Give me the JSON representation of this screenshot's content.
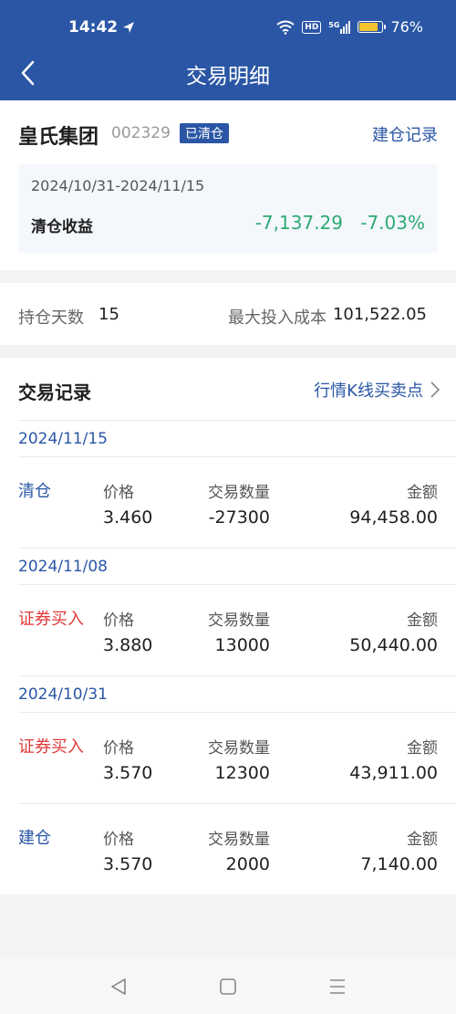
{
  "status_bar": {
    "time": "14:42",
    "hd": "HD",
    "network": "5G",
    "battery": "76%",
    "battery_level": 0.76
  },
  "header": {
    "title": "交易明细"
  },
  "stock": {
    "name": "皇氏集团",
    "code": "002329",
    "status": "已清仓",
    "open_record_link": "建仓记录"
  },
  "summary": {
    "period": "2024/10/31-2024/11/15",
    "label": "清仓收益",
    "profit": "-7,137.29",
    "profit_pct": "-7.03%"
  },
  "stats": {
    "days_label": "持仓天数",
    "days_value": "15",
    "cost_label": "最大投入成本",
    "cost_value": "101,522.05"
  },
  "records": {
    "title": "交易记录",
    "kline_link": "行情K线买卖点",
    "groups": [
      {
        "date": "2024/11/15",
        "items": [
          {
            "type": "清仓",
            "price_label": "价格",
            "price": "3.460",
            "qty_label": "交易数量",
            "qty": "-27300",
            "amount_label": "金额",
            "amount": "94,458.00"
          }
        ]
      },
      {
        "date": "2024/11/08",
        "items": [
          {
            "type": "证券买入",
            "price_label": "价格",
            "price": "3.880",
            "qty_label": "交易数量",
            "qty": "13000",
            "amount_label": "金额",
            "amount": "50,440.00"
          }
        ]
      },
      {
        "date": "2024/10/31",
        "items": [
          {
            "type": "证券买入",
            "price_label": "价格",
            "price": "3.570",
            "qty_label": "交易数量",
            "qty": "12300",
            "amount_label": "金额",
            "amount": "43,911.00"
          },
          {
            "type": "建仓",
            "price_label": "价格",
            "price": "3.570",
            "qty_label": "交易数量",
            "qty": "2000",
            "amount_label": "金额",
            "amount": "7,140.00"
          }
        ]
      }
    ]
  },
  "colors": {
    "brand": "#2a56a5",
    "gain_green": "#2eaa72",
    "buy_red": "#e03a3a"
  }
}
